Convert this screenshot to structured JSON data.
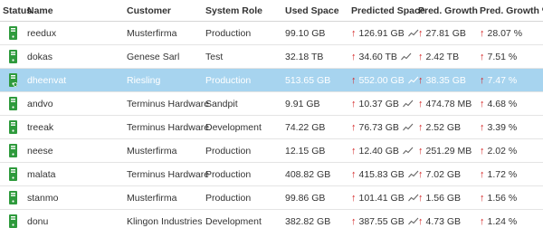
{
  "columns": {
    "status": "Status",
    "name": "Name",
    "customer": "Customer",
    "role": "System Role",
    "used": "Used Space",
    "predicted": "Predicted Space",
    "growth": "Pred. Growth",
    "pct": "Pred. Growth %"
  },
  "colors": {
    "server_green": "#2e9a3c",
    "selected_bg": "#a7d4ef",
    "arrow_red": "#d42020"
  },
  "rows": [
    {
      "name": "reedux",
      "customer": "Musterfirma",
      "role": "Production",
      "used": "99.10 GB",
      "predicted": "126.91 GB",
      "growth": "27.81 GB",
      "pct": "28.07 %"
    },
    {
      "name": "dokas",
      "customer": "Genese Sarl",
      "role": "Test",
      "used": "32.18 TB",
      "predicted": "34.60 TB",
      "growth": "2.42 TB",
      "pct": "7.51 %"
    },
    {
      "name": "dheenvat",
      "customer": "Riesling",
      "role": "Production",
      "used": "513.65 GB",
      "predicted": "552.00 GB",
      "growth": "38.35 GB",
      "pct": "7.47 %",
      "selected": true
    },
    {
      "name": "andvo",
      "customer": "Terminus Hardware",
      "role": "Sandpit",
      "used": "9.91 GB",
      "predicted": "10.37 GB",
      "growth": "474.78 MB",
      "pct": "4.68 %"
    },
    {
      "name": "treeak",
      "customer": "Terminus Hardware",
      "role": "Development",
      "used": "74.22 GB",
      "predicted": "76.73 GB",
      "growth": "2.52 GB",
      "pct": "3.39 %"
    },
    {
      "name": "neese",
      "customer": "Musterfirma",
      "role": "Production",
      "used": "12.15 GB",
      "predicted": "12.40 GB",
      "growth": "251.29 MB",
      "pct": "2.02 %"
    },
    {
      "name": "malata",
      "customer": "Terminus Hardware",
      "role": "Production",
      "used": "408.82 GB",
      "predicted": "415.83 GB",
      "growth": "7.02 GB",
      "pct": "1.72 %"
    },
    {
      "name": "stanmo",
      "customer": "Musterfirma",
      "role": "Production",
      "used": "99.86 GB",
      "predicted": "101.41 GB",
      "growth": "1.56 GB",
      "pct": "1.56 %"
    },
    {
      "name": "donu",
      "customer": "Klingon Industries",
      "role": "Development",
      "used": "382.82 GB",
      "predicted": "387.55 GB",
      "growth": "4.73 GB",
      "pct": "1.24 %"
    }
  ]
}
